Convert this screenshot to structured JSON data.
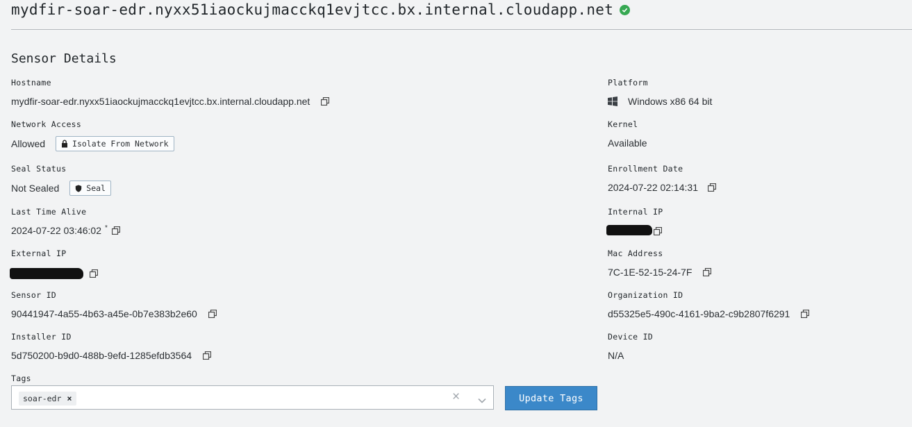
{
  "header": {
    "hostname_title": "mydfir-soar-edr.nyxx51iaockujmacckq1evjtcc.bx.internal.cloudapp.net",
    "status": "online",
    "status_color": "#36a852"
  },
  "section_title": "Sensor Details",
  "left": {
    "hostname": {
      "label": "Hostname",
      "value": "mydfir-soar-edr.nyxx51iaockujmacckq1evjtcc.bx.internal.cloudapp.net"
    },
    "network_access": {
      "label": "Network Access",
      "value": "Allowed",
      "button": "Isolate From Network"
    },
    "seal_status": {
      "label": "Seal Status",
      "value": "Not Sealed",
      "button": "Seal"
    },
    "last_time_alive": {
      "label": "Last Time Alive",
      "value": "2024-07-22 03:46:02",
      "marker": "*"
    },
    "external_ip": {
      "label": "External IP"
    },
    "sensor_id": {
      "label": "Sensor ID",
      "value": "90441947-4a55-4b63-a45e-0b7e383b2e60"
    },
    "installer_id": {
      "label": "Installer ID",
      "value": "5d750200-b9d0-488b-9efd-1285efdb3564"
    }
  },
  "right": {
    "platform": {
      "label": "Platform",
      "value": "Windows x86 64 bit",
      "icon": "windows-icon"
    },
    "kernel": {
      "label": "Kernel",
      "value": "Available"
    },
    "enrollment_date": {
      "label": "Enrollment Date",
      "value": "2024-07-22 02:14:31"
    },
    "internal_ip": {
      "label": "Internal IP"
    },
    "mac_address": {
      "label": "Mac Address",
      "value": "7C-1E-52-15-24-7F"
    },
    "organization_id": {
      "label": "Organization ID",
      "value": "d55325e5-490c-4161-9ba2-c9b2807f6291"
    },
    "device_id": {
      "label": "Device ID",
      "value": "N/A"
    }
  },
  "tags": {
    "label": "Tags",
    "items": [
      "soar-edr"
    ],
    "clear_symbol": "×",
    "update_button": "Update Tags"
  },
  "colors": {
    "accent_button": "#3b88c9",
    "background": "#f2f3f4"
  }
}
